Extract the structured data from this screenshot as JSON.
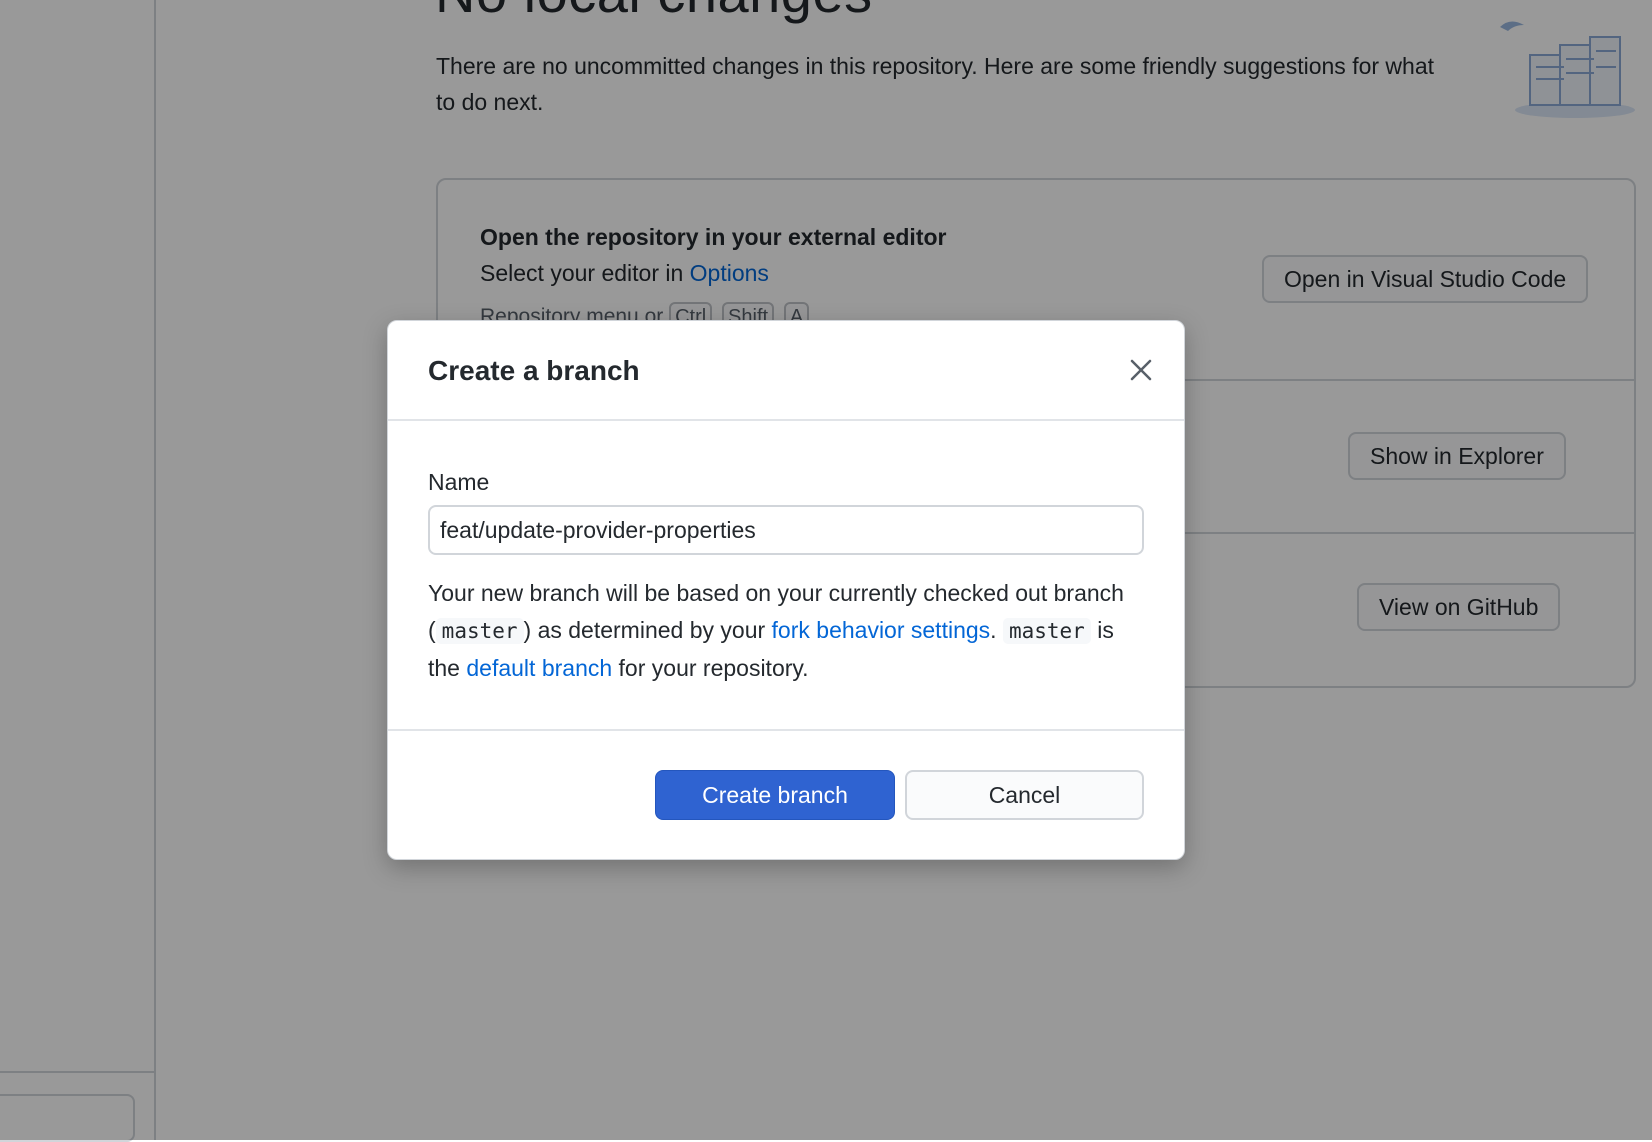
{
  "background": {
    "title": "No local changes",
    "intro": "There are no uncommitted changes in this repository. Here are some friendly suggestions for what to do next.",
    "editor_card": {
      "title": "Open the repository in your external editor",
      "desc_prefix": "Select your editor in ",
      "desc_link": "Options",
      "shortcut_prefix": "Repository menu or ",
      "keys": [
        "Ctrl",
        "Shift",
        "A"
      ],
      "button": "Open in Visual Studio Code"
    },
    "explorer_button": "Show in Explorer",
    "github_button": "View on GitHub"
  },
  "dialog": {
    "title": "Create a branch",
    "name_label": "Name",
    "name_value": "feat/update-provider-properties",
    "info": {
      "part1": "Your new branch will be based on your currently checked out branch (",
      "branch_code": "master",
      "part2": ") as determined by your ",
      "link1": "fork behavior settings",
      "part3": ". ",
      "default_code": "master",
      "part4": " is the ",
      "link2": "default branch",
      "part5": " for your repository."
    },
    "create_button": "Create branch",
    "cancel_button": "Cancel"
  },
  "colors": {
    "accent": "#2f63d1",
    "link": "#0366d6",
    "overlay": "rgba(0,0,0,0.4)"
  },
  "icons": [
    "close-icon",
    "repository-illustration"
  ]
}
